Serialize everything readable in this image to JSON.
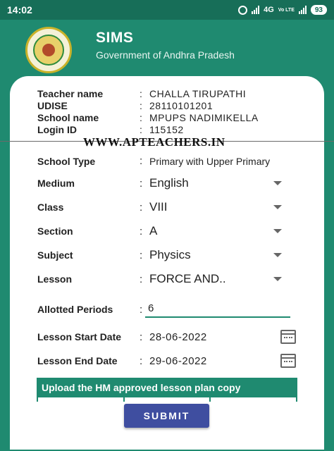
{
  "status_bar": {
    "time": "14:02",
    "network": "4G",
    "volte": "Vo LTE",
    "battery": "93"
  },
  "header": {
    "title": "SIMS",
    "subtitle": "Government of Andhra Pradesh"
  },
  "teacher_info": {
    "teacher_name_label": "Teacher name",
    "teacher_name": "CHALLA TIRUPATHI",
    "udise_label": "UDISE",
    "udise": "28110101201",
    "school_name_label": "School name",
    "school_name": "MPUPS NADIMIKELLA",
    "login_id_label": "Login ID",
    "login_id": "115152"
  },
  "watermark": "WWW.APTEACHERS.IN",
  "form": {
    "school_type_label": "School Type",
    "school_type": "Primary with Upper Primary",
    "medium_label": "Medium",
    "medium": "English",
    "class_label": "Class",
    "class": "VIII",
    "section_label": "Section",
    "section": "A",
    "subject_label": "Subject",
    "subject": "Physics",
    "lesson_label": "Lesson",
    "lesson": "FORCE AND..",
    "allotted_periods_label": "Allotted Periods",
    "allotted_periods": "6",
    "start_date_label": "Lesson Start Date",
    "start_date": "28-06-2022",
    "end_date_label": "Lesson End Date",
    "end_date": "29-06-2022",
    "colon": ":"
  },
  "upload_label": "Upload the HM approved lesson plan copy",
  "submit_label": "SUBMIT",
  "colors": {
    "primary": "#1f8a70",
    "status_bar": "#176e58",
    "button": "#3f4ea0"
  }
}
